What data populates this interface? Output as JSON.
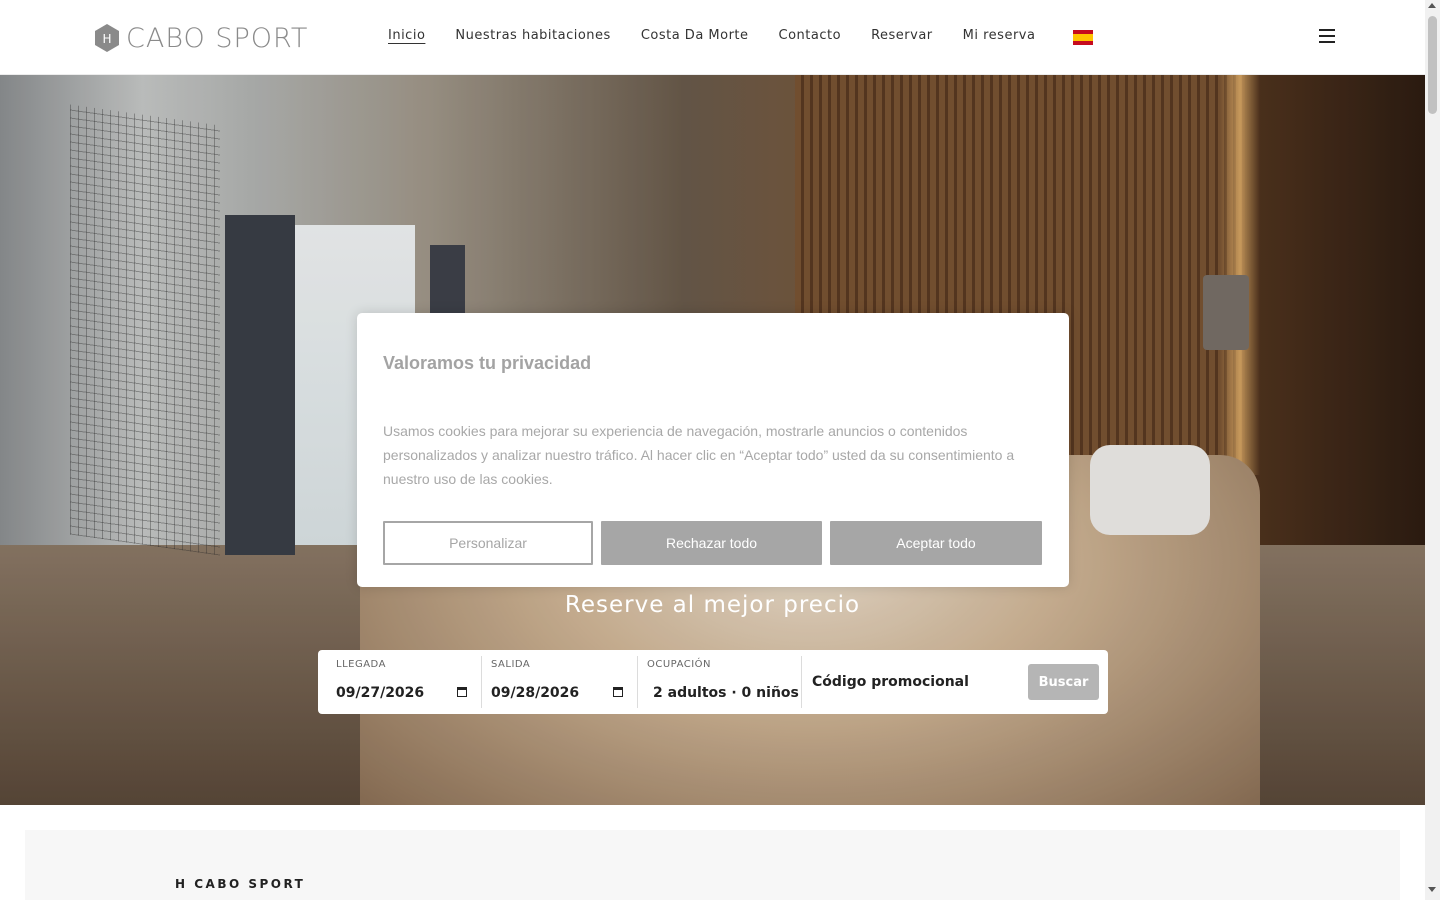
{
  "brand": {
    "name": "CABO SPORT",
    "logo_letter": "H"
  },
  "nav": {
    "items": [
      {
        "label": "Inicio",
        "active": true
      },
      {
        "label": "Nuestras habitaciones",
        "active": false
      },
      {
        "label": "Costa Da Morte",
        "active": false
      },
      {
        "label": "Contacto",
        "active": false
      },
      {
        "label": "Reservar",
        "active": false
      },
      {
        "label": "Mi reserva",
        "active": false
      }
    ],
    "language_icon": "spain-flag-icon",
    "menu_icon": "hamburger-menu-icon"
  },
  "hero": {
    "tagline": "Reserve al mejor precio"
  },
  "booking": {
    "arrival_label": "LLEGADA",
    "arrival_value": "09/27/2026",
    "departure_label": "SALIDA",
    "departure_value": "09/28/2026",
    "occupancy_label": "OCUPACIÓN",
    "occupancy_value": "2 adultos · 0 niños",
    "promo_placeholder": "Código promocional",
    "search_button": "Buscar"
  },
  "cookie_banner": {
    "title": "Valoramos tu privacidad",
    "text": "Usamos cookies para mejorar su experiencia de navegación, mostrarle anuncios o contenidos personalizados y analizar nuestro tráfico. Al hacer clic en “Aceptar todo” usted da su consentimiento a nuestro uso de las cookies.",
    "customize_button": "Personalizar",
    "reject_button": "Rechazar todo",
    "accept_button": "Aceptar todo"
  },
  "section": {
    "title": "H CABO SPORT"
  },
  "colors": {
    "button_gray": "#a6a6a6",
    "text_gray": "#a8a8a8",
    "accent_dark": "#222222"
  }
}
